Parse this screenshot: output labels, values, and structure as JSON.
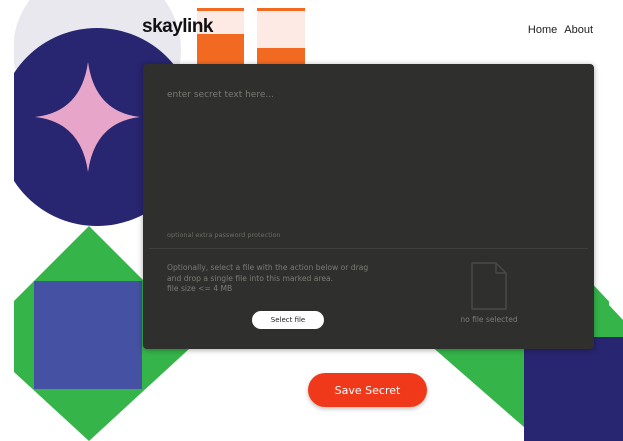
{
  "colors": {
    "navy": "#282571",
    "pink": "#e6a5c9",
    "green": "#35b44a",
    "blue_square": "#4551a3",
    "orange": "#f26a21",
    "peach": "#fdeae4",
    "panel": "#2f2f2d",
    "save_button": "#f0391a"
  },
  "header": {
    "brand": "skaylink",
    "nav": [
      {
        "label": "Home"
      },
      {
        "label": "About"
      }
    ]
  },
  "form": {
    "secret_placeholder": "enter secret text here...",
    "password_placeholder": "optional extra password protection",
    "file_hint_lines": [
      "Optionally, select a file with the action below or drag",
      "and drop a single file into this marked area.",
      "file size <= 4 MB"
    ],
    "select_file_label": "Select file",
    "file_icon": "document-icon",
    "no_file_text": "no file selected",
    "save_label": "Save Secret"
  }
}
